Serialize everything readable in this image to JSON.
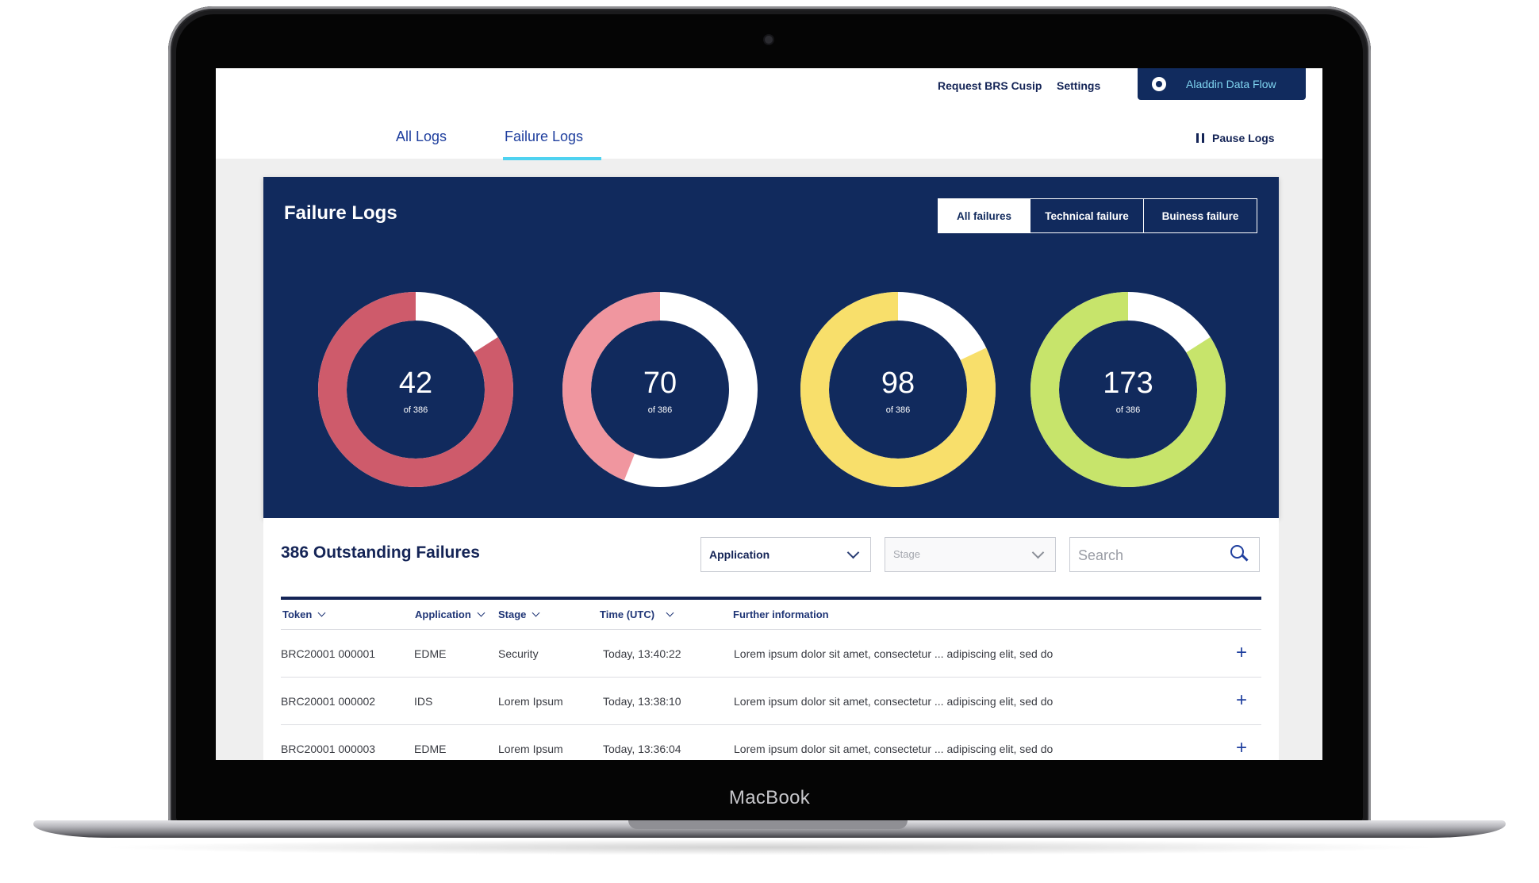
{
  "device": {
    "brand": "MacBook"
  },
  "header": {
    "links": [
      "Request BRS Cusip",
      "Settings"
    ],
    "brand_button": "Aladdin Data Flow",
    "tabs": [
      {
        "label": "All Logs"
      },
      {
        "label": "Failure Logs",
        "active": true
      }
    ],
    "pause_label": "Pause Logs"
  },
  "panel": {
    "title": "Failure Logs",
    "filters": [
      {
        "label": "All failures",
        "active": true
      },
      {
        "label": "Technical failure"
      },
      {
        "label": "Buiness failure"
      }
    ],
    "total": 386,
    "donuts": [
      {
        "value": "42",
        "sub": "of 386",
        "filled_fraction": 0.84,
        "color": "#ce5b6b",
        "remainder_color": "#ffffff"
      },
      {
        "value": "70",
        "sub": "of 386",
        "filled_fraction": 0.44,
        "color": "#f0969f",
        "remainder_color": "#ffffff"
      },
      {
        "value": "98",
        "sub": "of 386",
        "filled_fraction": 0.82,
        "color": "#f8df6b",
        "remainder_color": "#ffffff"
      },
      {
        "value": "173",
        "sub": "of 386",
        "filled_fraction": 0.84,
        "color": "#c7e46b",
        "remainder_color": "#ffffff"
      }
    ]
  },
  "table": {
    "title": "386 Outstanding Failures",
    "application_select": "Application",
    "stage_select": "Stage",
    "search_placeholder": "Search",
    "columns": [
      "Token",
      "Application",
      "Stage",
      "Time (UTC)",
      "Further information"
    ],
    "rows": [
      {
        "token": "BRC20001 000001",
        "application": "EDME",
        "stage": "Security",
        "time": "Today, 13:40:22",
        "info": "Lorem ipsum dolor sit amet, consectetur ... adipiscing elit, sed do"
      },
      {
        "token": "BRC20001 000002",
        "application": "IDS",
        "stage": "Lorem Ipsum",
        "time": "Today, 13:38:10",
        "info": "Lorem ipsum dolor sit amet, consectetur ... adipiscing elit, sed do"
      },
      {
        "token": "BRC20001 000003",
        "application": "EDME",
        "stage": "Lorem Ipsum",
        "time": "Today, 13:36:04",
        "info": "Lorem ipsum dolor sit amet, consectetur ... adipiscing elit, sed do"
      }
    ]
  },
  "colors": {
    "navy": "#112a5d",
    "accent_cyan": "#4fd2f0",
    "link_blue": "#1f3f9e"
  }
}
